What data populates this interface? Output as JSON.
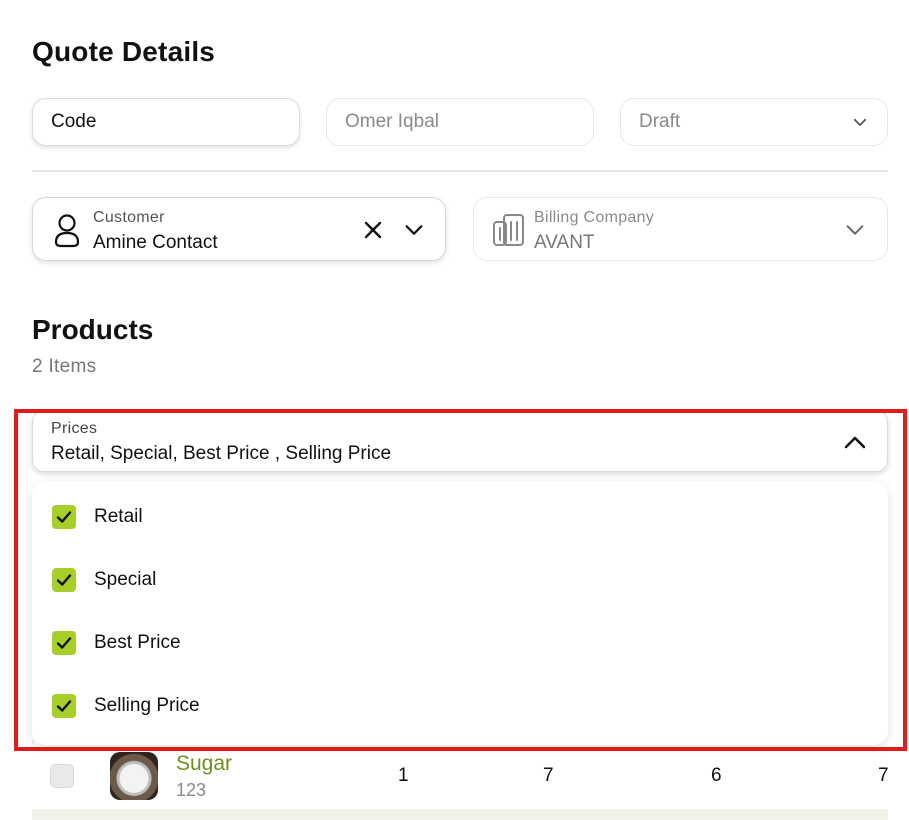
{
  "page": {
    "title": "Quote Details"
  },
  "form": {
    "code_placeholder": "Code",
    "owner_placeholder": "Omer Iqbal",
    "status_value": "Draft"
  },
  "customer": {
    "label": "Customer",
    "value": "Amine Contact",
    "icon": "user-icon"
  },
  "billing": {
    "label": "Billing Company",
    "value": "AVANT",
    "icon": "building-icon"
  },
  "products": {
    "heading": "Products",
    "count_text": "2 Items",
    "rows": [
      {
        "name": "Sugar",
        "sku": "123",
        "col1": "1",
        "col2": "7",
        "col3": "6",
        "col4": "7"
      }
    ]
  },
  "prices": {
    "label": "Prices",
    "value": "Retail, Special, Best Price , Selling Price",
    "options": [
      {
        "label": "Retail",
        "checked": true
      },
      {
        "label": "Special",
        "checked": true
      },
      {
        "label": "Best Price",
        "checked": true
      },
      {
        "label": "Selling Price",
        "checked": true
      }
    ]
  },
  "colors": {
    "accent": "#a6cf2a",
    "product_link": "#6f8e1d",
    "highlight": "#e01b1b"
  }
}
